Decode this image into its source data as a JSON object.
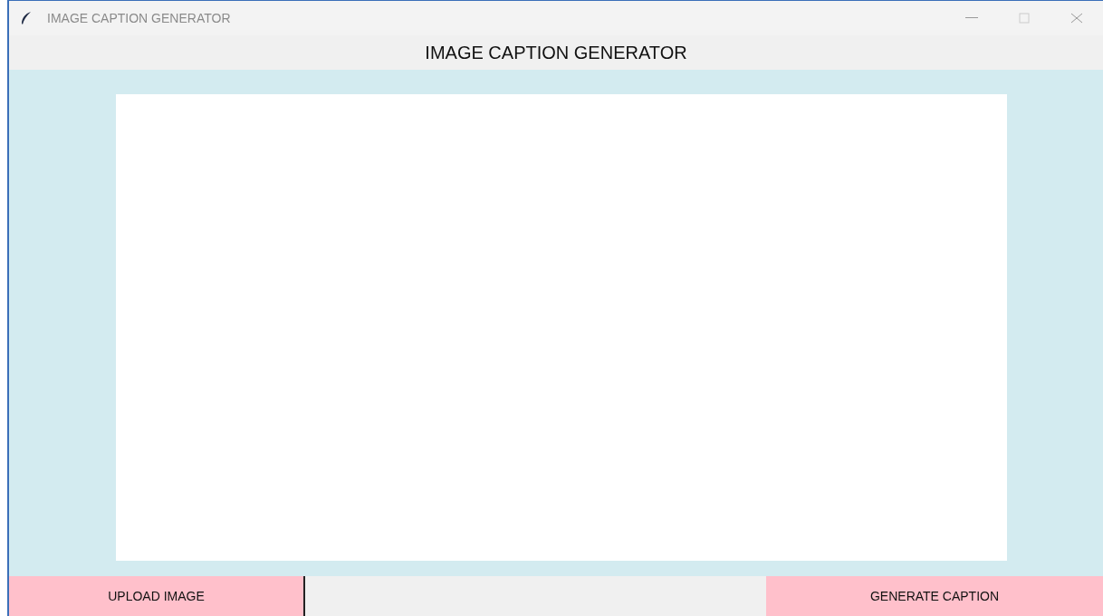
{
  "window": {
    "title": "IMAGE CAPTION GENERATOR"
  },
  "heading": "IMAGE CAPTION GENERATOR",
  "buttons": [
    {
      "label": "UPLOAD IMAGE"
    },
    {
      "label": "GENERATE CAPTION"
    }
  ]
}
